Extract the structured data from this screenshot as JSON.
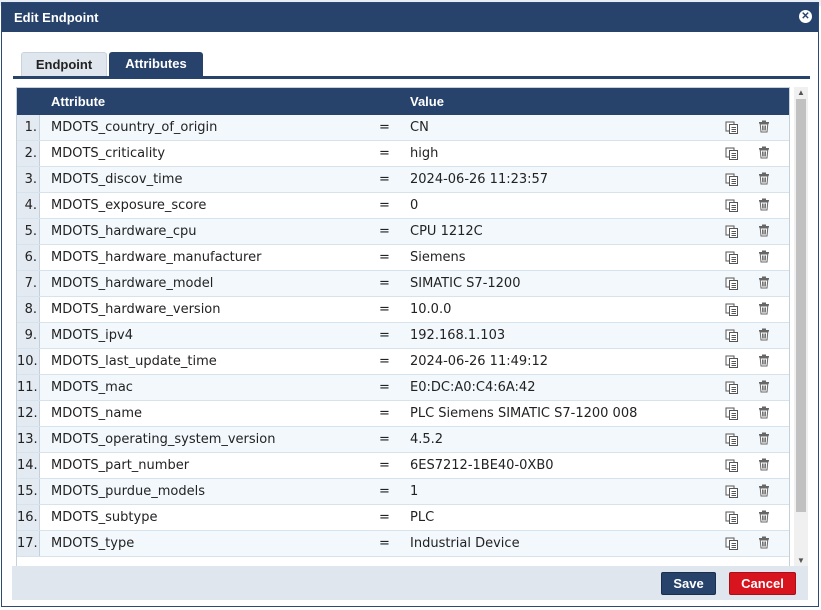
{
  "dialog": {
    "title": "Edit Endpoint",
    "close_icon": "close-icon"
  },
  "tabs": [
    {
      "label": "Endpoint",
      "active": false
    },
    {
      "label": "Attributes",
      "active": true
    }
  ],
  "table": {
    "headers": {
      "attribute": "Attribute",
      "value": "Value"
    },
    "rows": [
      {
        "num": "1.",
        "attribute": "MDOTS_country_of_origin",
        "eq": "=",
        "value": "CN"
      },
      {
        "num": "2.",
        "attribute": "MDOTS_criticality",
        "eq": "=",
        "value": "high"
      },
      {
        "num": "3.",
        "attribute": "MDOTS_discov_time",
        "eq": "=",
        "value": "2024-06-26 11:23:57"
      },
      {
        "num": "4.",
        "attribute": "MDOTS_exposure_score",
        "eq": "=",
        "value": "0"
      },
      {
        "num": "5.",
        "attribute": "MDOTS_hardware_cpu",
        "eq": "=",
        "value": "CPU 1212C"
      },
      {
        "num": "6.",
        "attribute": "MDOTS_hardware_manufacturer",
        "eq": "=",
        "value": "Siemens"
      },
      {
        "num": "7.",
        "attribute": "MDOTS_hardware_model",
        "eq": "=",
        "value": "SIMATIC S7-1200"
      },
      {
        "num": "8.",
        "attribute": "MDOTS_hardware_version",
        "eq": "=",
        "value": "10.0.0"
      },
      {
        "num": "9.",
        "attribute": "MDOTS_ipv4",
        "eq": "=",
        "value": "192.168.1.103"
      },
      {
        "num": "10.",
        "attribute": "MDOTS_last_update_time",
        "eq": "=",
        "value": "2024-06-26 11:49:12"
      },
      {
        "num": "11.",
        "attribute": "MDOTS_mac",
        "eq": "=",
        "value": "E0:DC:A0:C4:6A:42"
      },
      {
        "num": "12.",
        "attribute": "MDOTS_name",
        "eq": "=",
        "value": "PLC Siemens SIMATIC S7-1200 008"
      },
      {
        "num": "13.",
        "attribute": "MDOTS_operating_system_version",
        "eq": "=",
        "value": "4.5.2"
      },
      {
        "num": "14.",
        "attribute": "MDOTS_part_number",
        "eq": "=",
        "value": "6ES7212-1BE40-0XB0"
      },
      {
        "num": "15.",
        "attribute": "MDOTS_purdue_models",
        "eq": "=",
        "value": "1"
      },
      {
        "num": "16.",
        "attribute": "MDOTS_subtype",
        "eq": "=",
        "value": "PLC"
      },
      {
        "num": "17.",
        "attribute": "MDOTS_type",
        "eq": "=",
        "value": "Industrial Device"
      }
    ]
  },
  "footer": {
    "save_label": "Save",
    "cancel_label": "Cancel"
  },
  "colors": {
    "header_navy": "#27436b",
    "cancel_red": "#d8141f",
    "row_alt": "#f2f8fc"
  }
}
